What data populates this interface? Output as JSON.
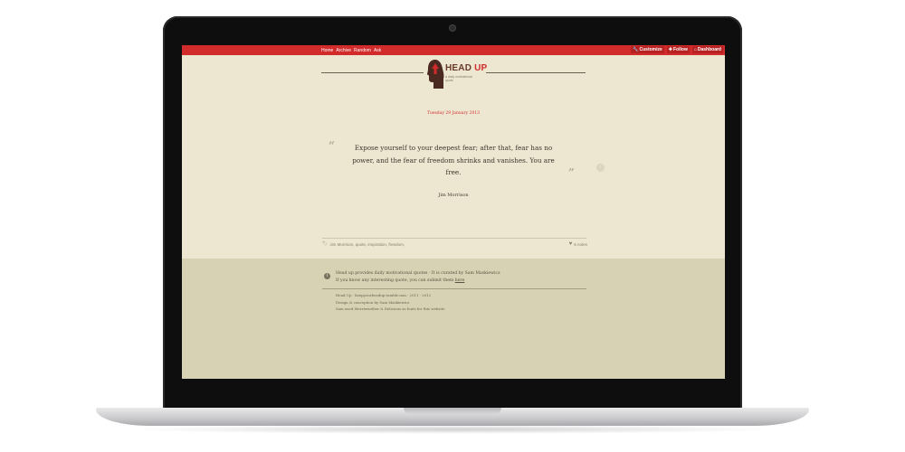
{
  "topbar": {
    "nav": [
      "Home",
      "Archive",
      "Random",
      "Ask"
    ],
    "controls": [
      {
        "icon": "wrench-icon",
        "label": "Customize"
      },
      {
        "icon": "plus-icon",
        "label": "Follow"
      },
      {
        "icon": "home-icon",
        "label": "Dashboard"
      }
    ]
  },
  "logo": {
    "brand_head": "HEAD",
    "brand_up": "UP",
    "tagline": "a daily motivational quote"
  },
  "post": {
    "date": "Tuesday 29 January 2013",
    "quote": "Expose yourself to your deepest fear; after that, fear has no power, and the fear of freedom shrinks and vanishes. You are free.",
    "author": "Jim Morrison",
    "tags": "Jim Morrison,  quote,  inspiration,  freedom,",
    "notes": "6 notes"
  },
  "footer": {
    "info_line1": "Head up provides daily motivational quotes · It is curated by Sam Maskiewicz",
    "info_line2_prefix": "If you know any interesting quote, you can submit them ",
    "info_link": "here",
    "credits": [
      "Head Up · keepyourheadup.tumblr.com · 2011 - 2012",
      "Design & conception by Sam Maskiewicz",
      "Sam used Merriweather & Delicious as fonts for this website"
    ]
  },
  "colors": {
    "accent": "#d22b2b",
    "page_bg": "#ede6d1",
    "footer_bg": "#d7d2b4"
  }
}
